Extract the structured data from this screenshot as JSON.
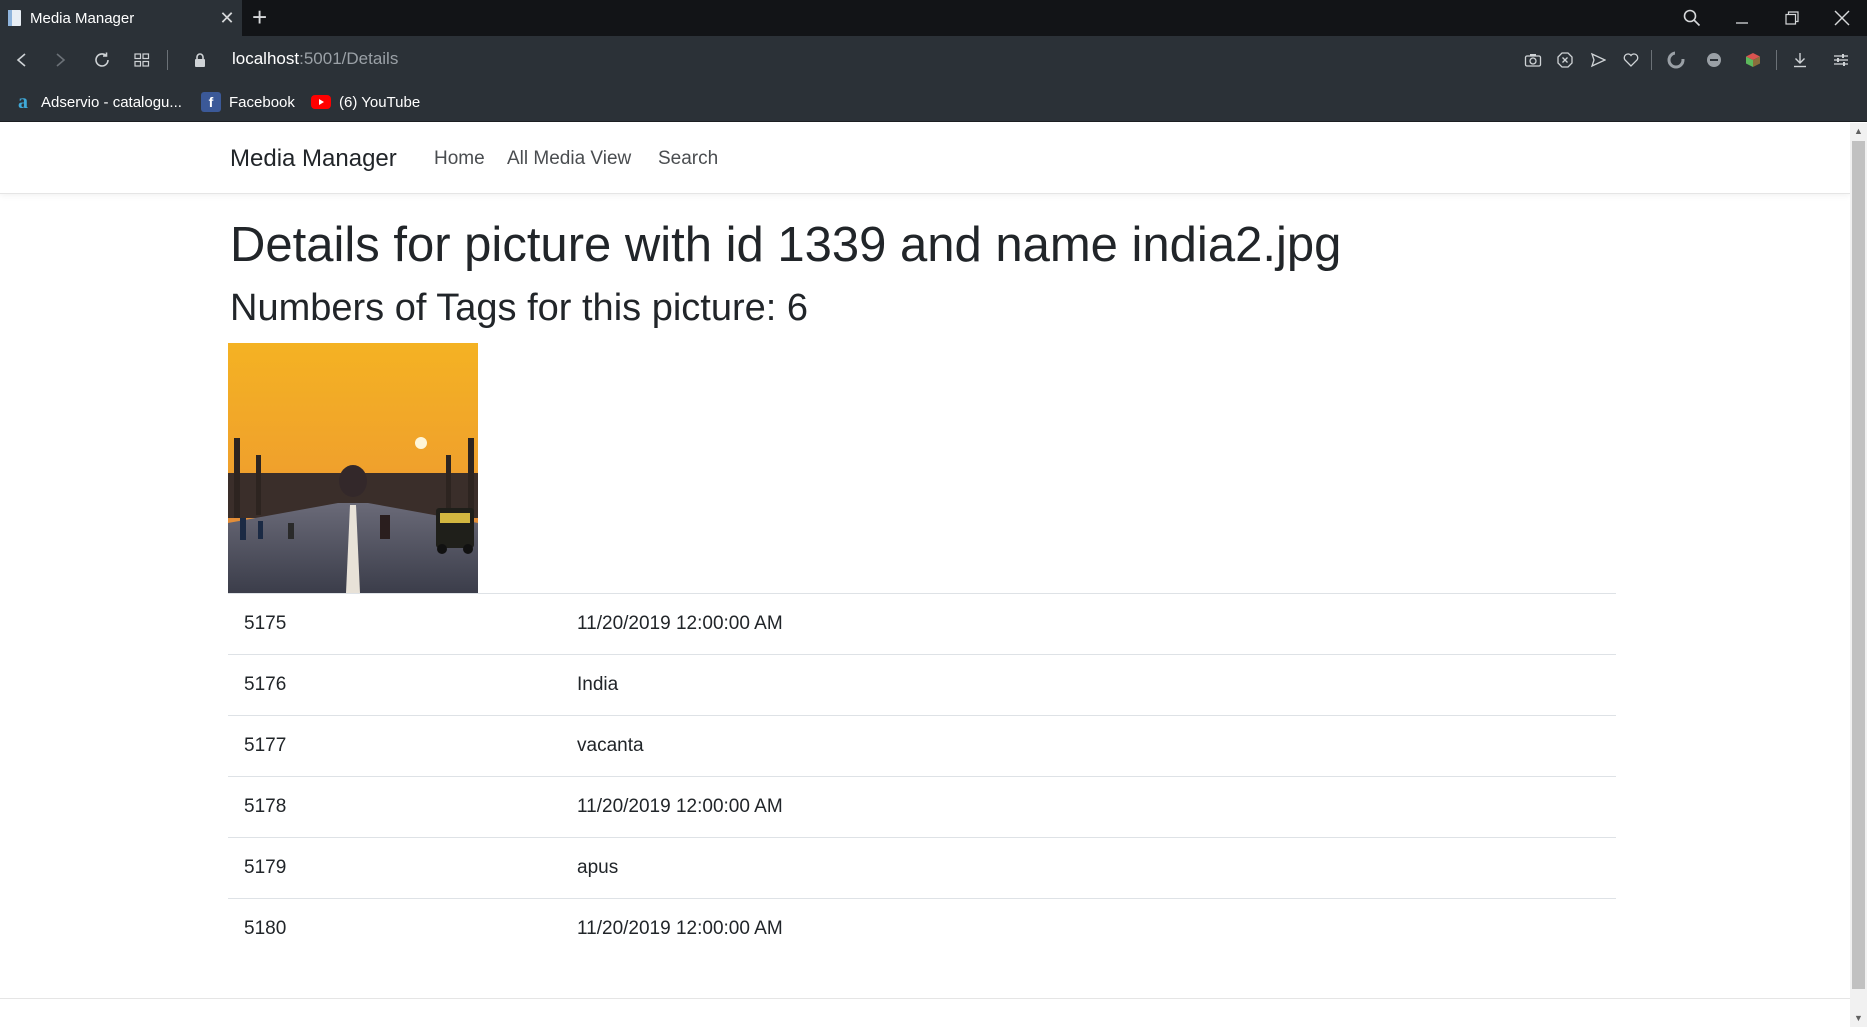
{
  "browser": {
    "tab_title": "Media Manager",
    "url_host": "localhost",
    "url_path": ":5001/Details",
    "bookmarks": [
      {
        "label": "Adservio - catalogu...",
        "icon": "adservio-icon",
        "color": "#3fa9d8"
      },
      {
        "label": "Facebook",
        "icon": "facebook-icon",
        "color": "#3b5998"
      },
      {
        "label": "(6) YouTube",
        "icon": "youtube-icon",
        "color": "#ff0000"
      }
    ]
  },
  "nav": {
    "brand": "Media Manager",
    "links": [
      "Home",
      "All Media View",
      "Search"
    ]
  },
  "details": {
    "title": "Details for picture with id 1339 and name india2.jpg",
    "tag_count_text": "Numbers of Tags for this picture: 6"
  },
  "tags": [
    {
      "id": "5175",
      "value": "11/20/2019 12:00:00 AM"
    },
    {
      "id": "5176",
      "value": "India"
    },
    {
      "id": "5177",
      "value": "vacanta"
    },
    {
      "id": "5178",
      "value": "11/20/2019 12:00:00 AM"
    },
    {
      "id": "5179",
      "value": "apus"
    },
    {
      "id": "5180",
      "value": "11/20/2019 12:00:00 AM"
    }
  ],
  "colors": {
    "browser_dark": "#121417",
    "browser_bar": "#2b3137",
    "text": "#212529"
  }
}
